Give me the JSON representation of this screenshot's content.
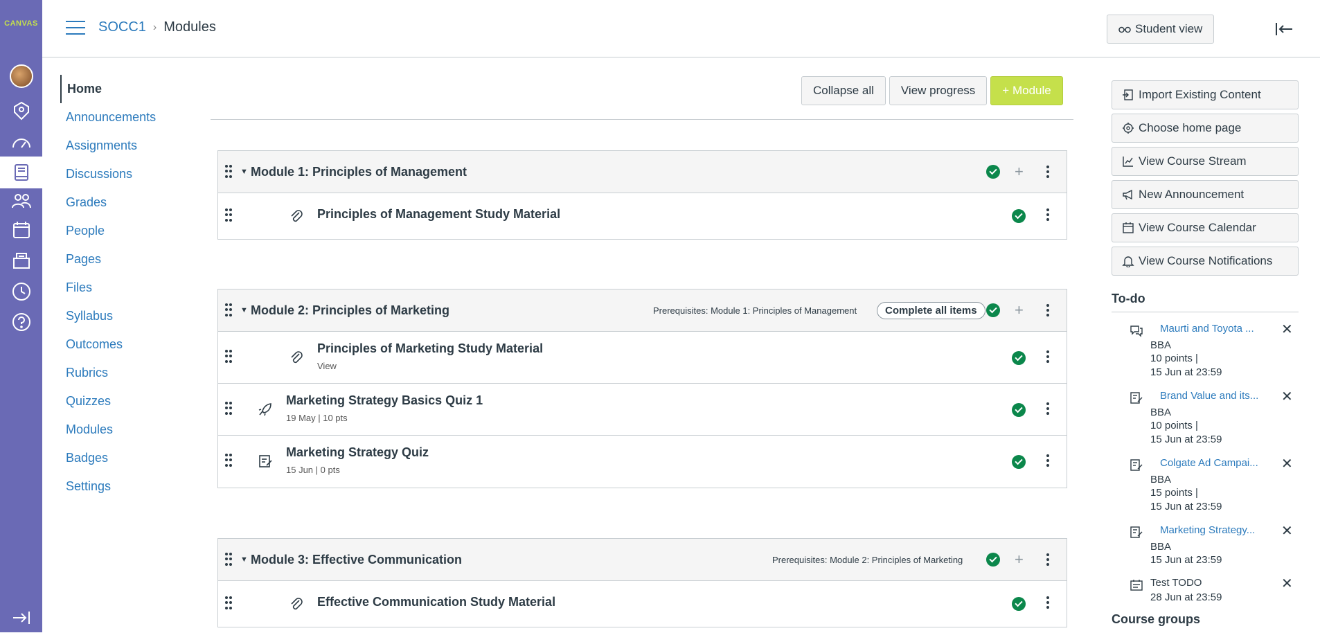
{
  "global_nav": {
    "logo": "CANVAS",
    "items": [
      {
        "icon": "account-avatar-icon"
      },
      {
        "icon": "admin-icon"
      },
      {
        "icon": "dashboard-icon"
      },
      {
        "icon": "courses-icon",
        "active": true
      },
      {
        "icon": "groups-icon"
      },
      {
        "icon": "calendar-icon"
      },
      {
        "icon": "inbox-icon"
      },
      {
        "icon": "history-icon"
      },
      {
        "icon": "help-icon"
      }
    ]
  },
  "breadcrumb": {
    "course": "SOCC1",
    "separator": "›",
    "page": "Modules"
  },
  "header": {
    "student_view": "Student view"
  },
  "course_nav": [
    "Home",
    "Announcements",
    "Assignments",
    "Discussions",
    "Grades",
    "People",
    "Pages",
    "Files",
    "Syllabus",
    "Outcomes",
    "Rubrics",
    "Quizzes",
    "Modules",
    "Badges",
    "Settings"
  ],
  "toolbar": {
    "collapse_all": "Collapse all",
    "view_progress": "View progress",
    "add_module": "+ Module"
  },
  "modules": [
    {
      "title": "Module 1: Principles of Management",
      "prerequisites": "",
      "requirement": "",
      "items": [
        {
          "title": "Principles of Management Study Material",
          "sub": "",
          "icon": "attachment-icon"
        }
      ]
    },
    {
      "title": "Module 2: Principles of Marketing",
      "prerequisites": "Prerequisites: Module 1: Principles of Management",
      "requirement": "Complete all items",
      "items": [
        {
          "title": "Principles of Marketing Study Material",
          "sub": "View",
          "icon": "attachment-icon"
        },
        {
          "title": "Marketing Strategy Basics Quiz 1",
          "sub": "19 May  |  10 pts",
          "icon": "rocket-quiz-icon"
        },
        {
          "title": "Marketing Strategy Quiz",
          "sub": "15 Jun  |  0 pts",
          "icon": "quiz-icon"
        }
      ]
    },
    {
      "title": "Module 3: Effective Communication",
      "prerequisites": "Prerequisites: Module 2: Principles of Marketing",
      "requirement": "",
      "items": [
        {
          "title": "Effective Communication Study Material",
          "sub": "",
          "icon": "attachment-icon"
        }
      ]
    }
  ],
  "sidebar": {
    "buttons": [
      "Import Existing Content",
      "Choose home page",
      "View Course Stream",
      "New Announcement",
      "View Course Calendar",
      "View Course Notifications"
    ],
    "todo_heading": "To-do",
    "todos": [
      {
        "title": "Maurti and Toyota ...",
        "course": "BBA",
        "points": "10 points  |",
        "due": "15 Jun at 23:59",
        "icon": "discussion-icon"
      },
      {
        "title": "Brand Value and its...",
        "course": "BBA",
        "points": "10 points  |",
        "due": "15 Jun at 23:59",
        "icon": "assignment-icon"
      },
      {
        "title": "Colgate Ad Campai...",
        "course": "BBA",
        "points": "15 points  |",
        "due": "15 Jun at 23:59",
        "icon": "assignment-icon"
      },
      {
        "title": "Marketing Strategy...",
        "course": "BBA",
        "points": "",
        "due": "15 Jun at 23:59",
        "icon": "assignment-icon"
      },
      {
        "title": "Test TODO",
        "course": "",
        "points": "",
        "due": "28 Jun at 23:59",
        "icon": "todo-icon"
      }
    ],
    "course_groups": "Course groups"
  }
}
